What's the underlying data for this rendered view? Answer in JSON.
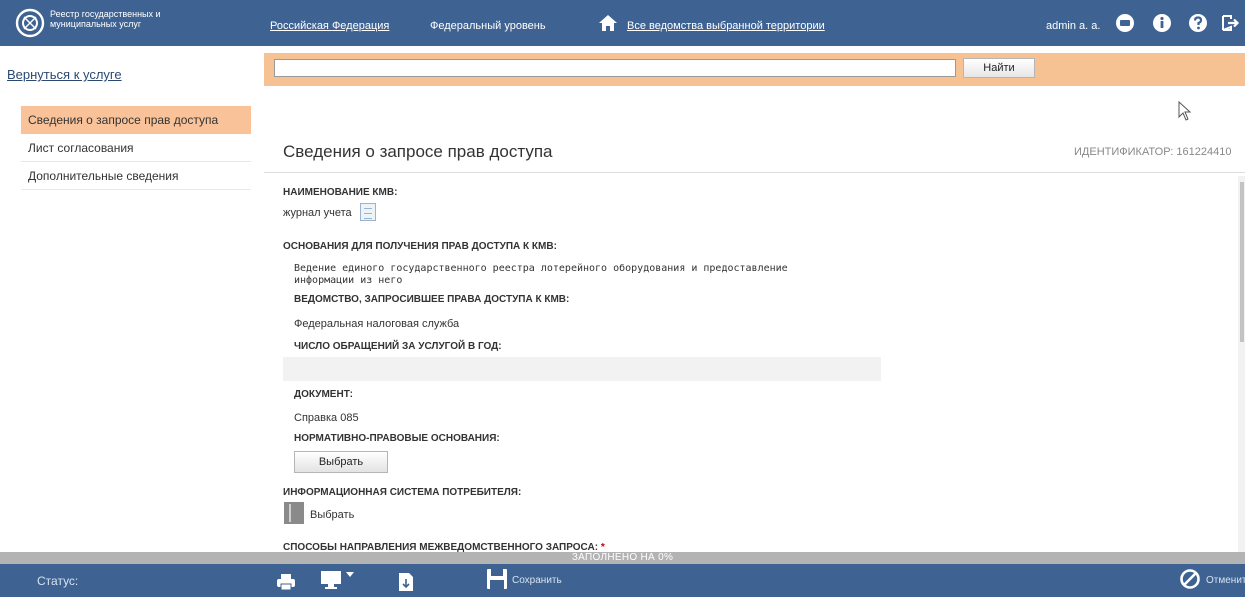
{
  "header": {
    "logo_line1": "Реестр государственных и",
    "logo_line2": "муниципальных услуг",
    "region_link": "Российская Федерация",
    "level_link": "Федеральный уровень",
    "departments_link": "Все ведомства выбранной территории",
    "user_name": "admin a. a."
  },
  "sidebar": {
    "back_link": "Вернуться к услуге",
    "items": [
      {
        "label": "Сведения о запросе прав доступа",
        "active": true
      },
      {
        "label": "Лист согласования",
        "active": false
      },
      {
        "label": "Дополнительные сведения",
        "active": false
      }
    ]
  },
  "search": {
    "value": "",
    "button_label": "Найти"
  },
  "main": {
    "title": "Сведения о запросе прав доступа",
    "identifier": "ИДЕНТИФИКАТОР: 161224410",
    "kmv_label": "НАИМЕНОВАНИЕ КМВ:",
    "kmv_value": "журнал учета",
    "basis_label": "ОСНОВАНИЯ ДЛЯ ПОЛУЧЕНИЯ ПРАВ ДОСТУПА К КМВ:",
    "basis_line1": "Ведение единого государственного реестра лотерейного оборудования и предоставление",
    "basis_line2": "информации из него",
    "dept_label": "ВЕДОМСТВО, ЗАПРОСИВШЕЕ ПРАВА ДОСТУПА К КМВ:",
    "dept_value": "Федеральная налоговая служба",
    "count_label": "ЧИСЛО ОБРАЩЕНИЙ ЗА УСЛУГОЙ В ГОД:",
    "count_value": "",
    "doc_label": "ДОКУМЕНТ:",
    "doc_value": "Справка 085",
    "legal_label": "НОРМАТИВНО-ПРАВОВЫЕ ОСНОВАНИЯ:",
    "legal_button": "Выбрать",
    "infosys_label": "ИНФОРМАЦИОННАЯ СИСТЕМА ПОТРЕБИТЕЛЯ:",
    "infosys_select": "Выбрать",
    "methods_label": "СПОСОБЫ НАПРАВЛЕНИЯ МЕЖВЕДОМСТВЕННОГО ЗАПРОСА:",
    "required_mark": "*"
  },
  "progress": {
    "text": "ЗАПОЛНЕНО НА 0%",
    "percent": 0
  },
  "statusbar": {
    "status_label": "Статус:",
    "save_label": "Сохранить",
    "cancel_label": "Отменить"
  },
  "colors": {
    "top_bar": "#3e6393",
    "accent_orange": "#f6c294",
    "active_item": "#f9c298"
  }
}
